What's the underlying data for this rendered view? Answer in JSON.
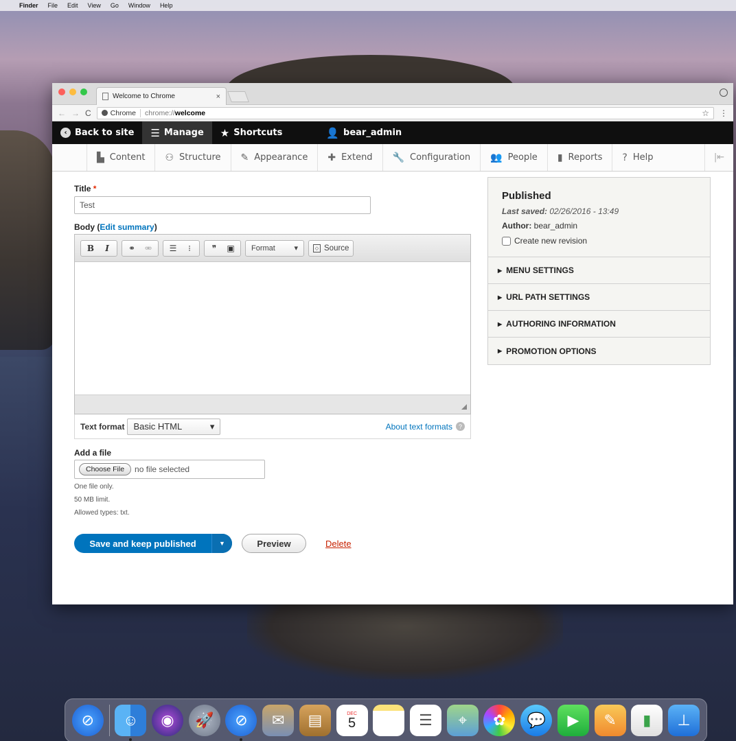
{
  "menubar": {
    "apple": "",
    "app": "Finder",
    "items": [
      "File",
      "Edit",
      "View",
      "Go",
      "Window",
      "Help"
    ]
  },
  "browser": {
    "tab_title": "Welcome to Chrome",
    "tab_close": "×",
    "omnibox_chip": "Chrome",
    "url_prefix": "chrome://",
    "url_host": "welcome"
  },
  "admin_toolbar": {
    "back": "Back to site",
    "manage": "Manage",
    "shortcuts": "Shortcuts",
    "user": "bear_admin"
  },
  "tray": {
    "items": [
      {
        "label": "Content",
        "icon": "content-icon"
      },
      {
        "label": "Structure",
        "icon": "structure-icon"
      },
      {
        "label": "Appearance",
        "icon": "appearance-icon"
      },
      {
        "label": "Extend",
        "icon": "extend-icon"
      },
      {
        "label": "Configuration",
        "icon": "configuration-icon"
      },
      {
        "label": "People",
        "icon": "people-icon"
      },
      {
        "label": "Reports",
        "icon": "reports-icon"
      },
      {
        "label": "Help",
        "icon": "help-icon"
      }
    ]
  },
  "form": {
    "title_label": "Title",
    "required_mark": "*",
    "title_value": "Test",
    "body_label": "Body",
    "body_open": "(",
    "edit_summary": "Edit summary",
    "body_close": ")",
    "editor": {
      "bold": "B",
      "italic": "I",
      "format_label": "Format",
      "source_label": "Source"
    },
    "text_format_label": "Text format",
    "text_format_value": "Basic HTML",
    "about_text_formats": "About text formats",
    "file_label": "Add a file",
    "choose_file": "Choose File",
    "no_file": "no file selected",
    "help_one_file": "One file only.",
    "help_limit": "50 MB limit.",
    "help_types": "Allowed types: txt.",
    "save_button": "Save and keep published",
    "preview_button": "Preview",
    "delete_link": "Delete"
  },
  "sidebar": {
    "status": "Published",
    "last_saved_label": "Last saved:",
    "last_saved_value": "02/26/2016 - 13:49",
    "author_label": "Author:",
    "author_value": "bear_admin",
    "revision_label": "Create new revision",
    "sections": [
      "MENU SETTINGS",
      "URL PATH SETTINGS",
      "AUTHORING INFORMATION",
      "PROMOTION OPTIONS"
    ]
  },
  "dock": {
    "calendar_month": "DEC",
    "calendar_day": "5"
  },
  "colors": {
    "drupal_blue": "#0074bd",
    "admin_bar": "#0f0f0f",
    "delete_red": "#c72100"
  }
}
